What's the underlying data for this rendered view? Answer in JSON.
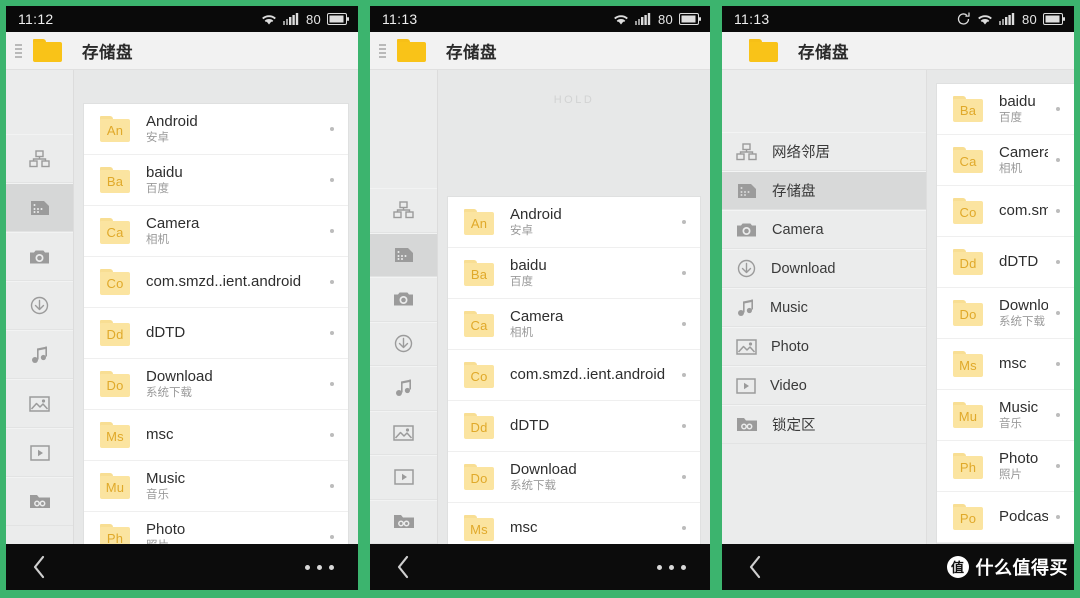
{
  "theme": {
    "background_green": "#3cb46e",
    "screen_bg": "#eceded",
    "folder_accent": "#f9c318",
    "folder_tile": "#fbe4a0",
    "folder_abbr_color": "#e0a92a",
    "statusbar_bg": "#0a0a0a",
    "selected_row": "#d6d7d7"
  },
  "panels": [
    {
      "id": "panel-1",
      "status": {
        "time": "11:12",
        "battery": "80",
        "icons": [
          "wifi-icon",
          "signal-icon",
          "battery-icon"
        ]
      },
      "titlebar": {
        "title": "存储盘",
        "has_grip": true,
        "folder_icon": "folder-icon"
      },
      "rail": [
        {
          "name": "network-neighborhood",
          "icon": "network-icon",
          "selected": false
        },
        {
          "name": "storage",
          "icon": "storage-icon",
          "selected": true
        },
        {
          "name": "camera",
          "icon": "camera-icon",
          "selected": false
        },
        {
          "name": "download",
          "icon": "download-icon",
          "selected": false
        },
        {
          "name": "music",
          "icon": "music-icon",
          "selected": false
        },
        {
          "name": "photo",
          "icon": "photo-icon",
          "selected": false
        },
        {
          "name": "video",
          "icon": "video-icon",
          "selected": false
        },
        {
          "name": "locked",
          "icon": "lock-folder-icon",
          "selected": false
        }
      ],
      "hold_label": "",
      "files": [
        {
          "abbr": "An",
          "name": "Android",
          "sub": "安卓"
        },
        {
          "abbr": "Ba",
          "name": "baidu",
          "sub": "百度"
        },
        {
          "abbr": "Ca",
          "name": "Camera",
          "sub": "相机"
        },
        {
          "abbr": "Co",
          "name": "com.smzd..ient.android",
          "sub": ""
        },
        {
          "abbr": "Dd",
          "name": "dDTD",
          "sub": ""
        },
        {
          "abbr": "Do",
          "name": "Download",
          "sub": "系统下载"
        },
        {
          "abbr": "Ms",
          "name": "msc",
          "sub": ""
        },
        {
          "abbr": "Mu",
          "name": "Music",
          "sub": "音乐"
        },
        {
          "abbr": "Ph",
          "name": "Photo",
          "sub": "照片"
        }
      ],
      "navbar": {
        "back": "back-icon",
        "menu": "more-dots-icon",
        "watermark": null
      }
    },
    {
      "id": "panel-2",
      "status": {
        "time": "11:13",
        "battery": "80",
        "icons": [
          "wifi-icon",
          "signal-icon",
          "battery-icon"
        ]
      },
      "titlebar": {
        "title": "存储盘",
        "has_grip": true,
        "folder_icon": "folder-icon"
      },
      "rail": [
        {
          "name": "network-neighborhood",
          "icon": "network-icon",
          "selected": false
        },
        {
          "name": "storage",
          "icon": "storage-icon",
          "selected": true
        },
        {
          "name": "camera",
          "icon": "camera-icon",
          "selected": false
        },
        {
          "name": "download",
          "icon": "download-icon",
          "selected": false
        },
        {
          "name": "music",
          "icon": "music-icon",
          "selected": false
        },
        {
          "name": "photo",
          "icon": "photo-icon",
          "selected": false
        },
        {
          "name": "video",
          "icon": "video-icon",
          "selected": false
        },
        {
          "name": "locked",
          "icon": "lock-folder-icon",
          "selected": false
        }
      ],
      "hold_label": "HOLD",
      "files": [
        {
          "abbr": "An",
          "name": "Android",
          "sub": "安卓"
        },
        {
          "abbr": "Ba",
          "name": "baidu",
          "sub": "百度"
        },
        {
          "abbr": "Ca",
          "name": "Camera",
          "sub": "相机"
        },
        {
          "abbr": "Co",
          "name": "com.smzd..ient.android",
          "sub": ""
        },
        {
          "abbr": "Dd",
          "name": "dDTD",
          "sub": ""
        },
        {
          "abbr": "Do",
          "name": "Download",
          "sub": "系统下载"
        },
        {
          "abbr": "Ms",
          "name": "msc",
          "sub": ""
        }
      ],
      "navbar": {
        "back": "back-icon",
        "menu": "more-dots-icon",
        "watermark": null
      }
    },
    {
      "id": "panel-3",
      "status": {
        "time": "11:13",
        "battery": "80",
        "icons": [
          "sync-icon",
          "wifi-icon",
          "signal-icon",
          "battery-icon"
        ]
      },
      "titlebar": {
        "title": "存储盘",
        "has_grip": false,
        "folder_icon": "folder-icon"
      },
      "sidenav": [
        {
          "name": "network-neighborhood",
          "label": "网络邻居",
          "icon": "network-icon",
          "selected": false
        },
        {
          "name": "storage",
          "label": "存储盘",
          "icon": "storage-icon",
          "selected": true
        },
        {
          "name": "camera",
          "label": "Camera",
          "icon": "camera-icon",
          "selected": false
        },
        {
          "name": "download",
          "label": "Download",
          "icon": "download-icon",
          "selected": false
        },
        {
          "name": "music",
          "label": "Music",
          "icon": "music-icon",
          "selected": false
        },
        {
          "name": "photo",
          "label": "Photo",
          "icon": "photo-icon",
          "selected": false
        },
        {
          "name": "video",
          "label": "Video",
          "icon": "video-icon",
          "selected": false
        },
        {
          "name": "locked",
          "label": "锁定区",
          "icon": "lock-folder-icon",
          "selected": false
        }
      ],
      "files": [
        {
          "abbr": "Ba",
          "name": "baidu",
          "sub": "百度"
        },
        {
          "abbr": "Ca",
          "name": "Camera",
          "sub": "相机"
        },
        {
          "abbr": "Co",
          "name": "com.smzd..",
          "sub": ""
        },
        {
          "abbr": "Dd",
          "name": "dDTD",
          "sub": ""
        },
        {
          "abbr": "Do",
          "name": "Download",
          "sub": "系统下载"
        },
        {
          "abbr": "Ms",
          "name": "msc",
          "sub": ""
        },
        {
          "abbr": "Mu",
          "name": "Music",
          "sub": "音乐"
        },
        {
          "abbr": "Ph",
          "name": "Photo",
          "sub": "照片"
        },
        {
          "abbr": "Po",
          "name": "Podcasts",
          "sub": ""
        }
      ],
      "navbar": {
        "back": "back-icon",
        "menu": null,
        "watermark": {
          "badge": "值",
          "text": "什么值得买"
        }
      }
    }
  ]
}
